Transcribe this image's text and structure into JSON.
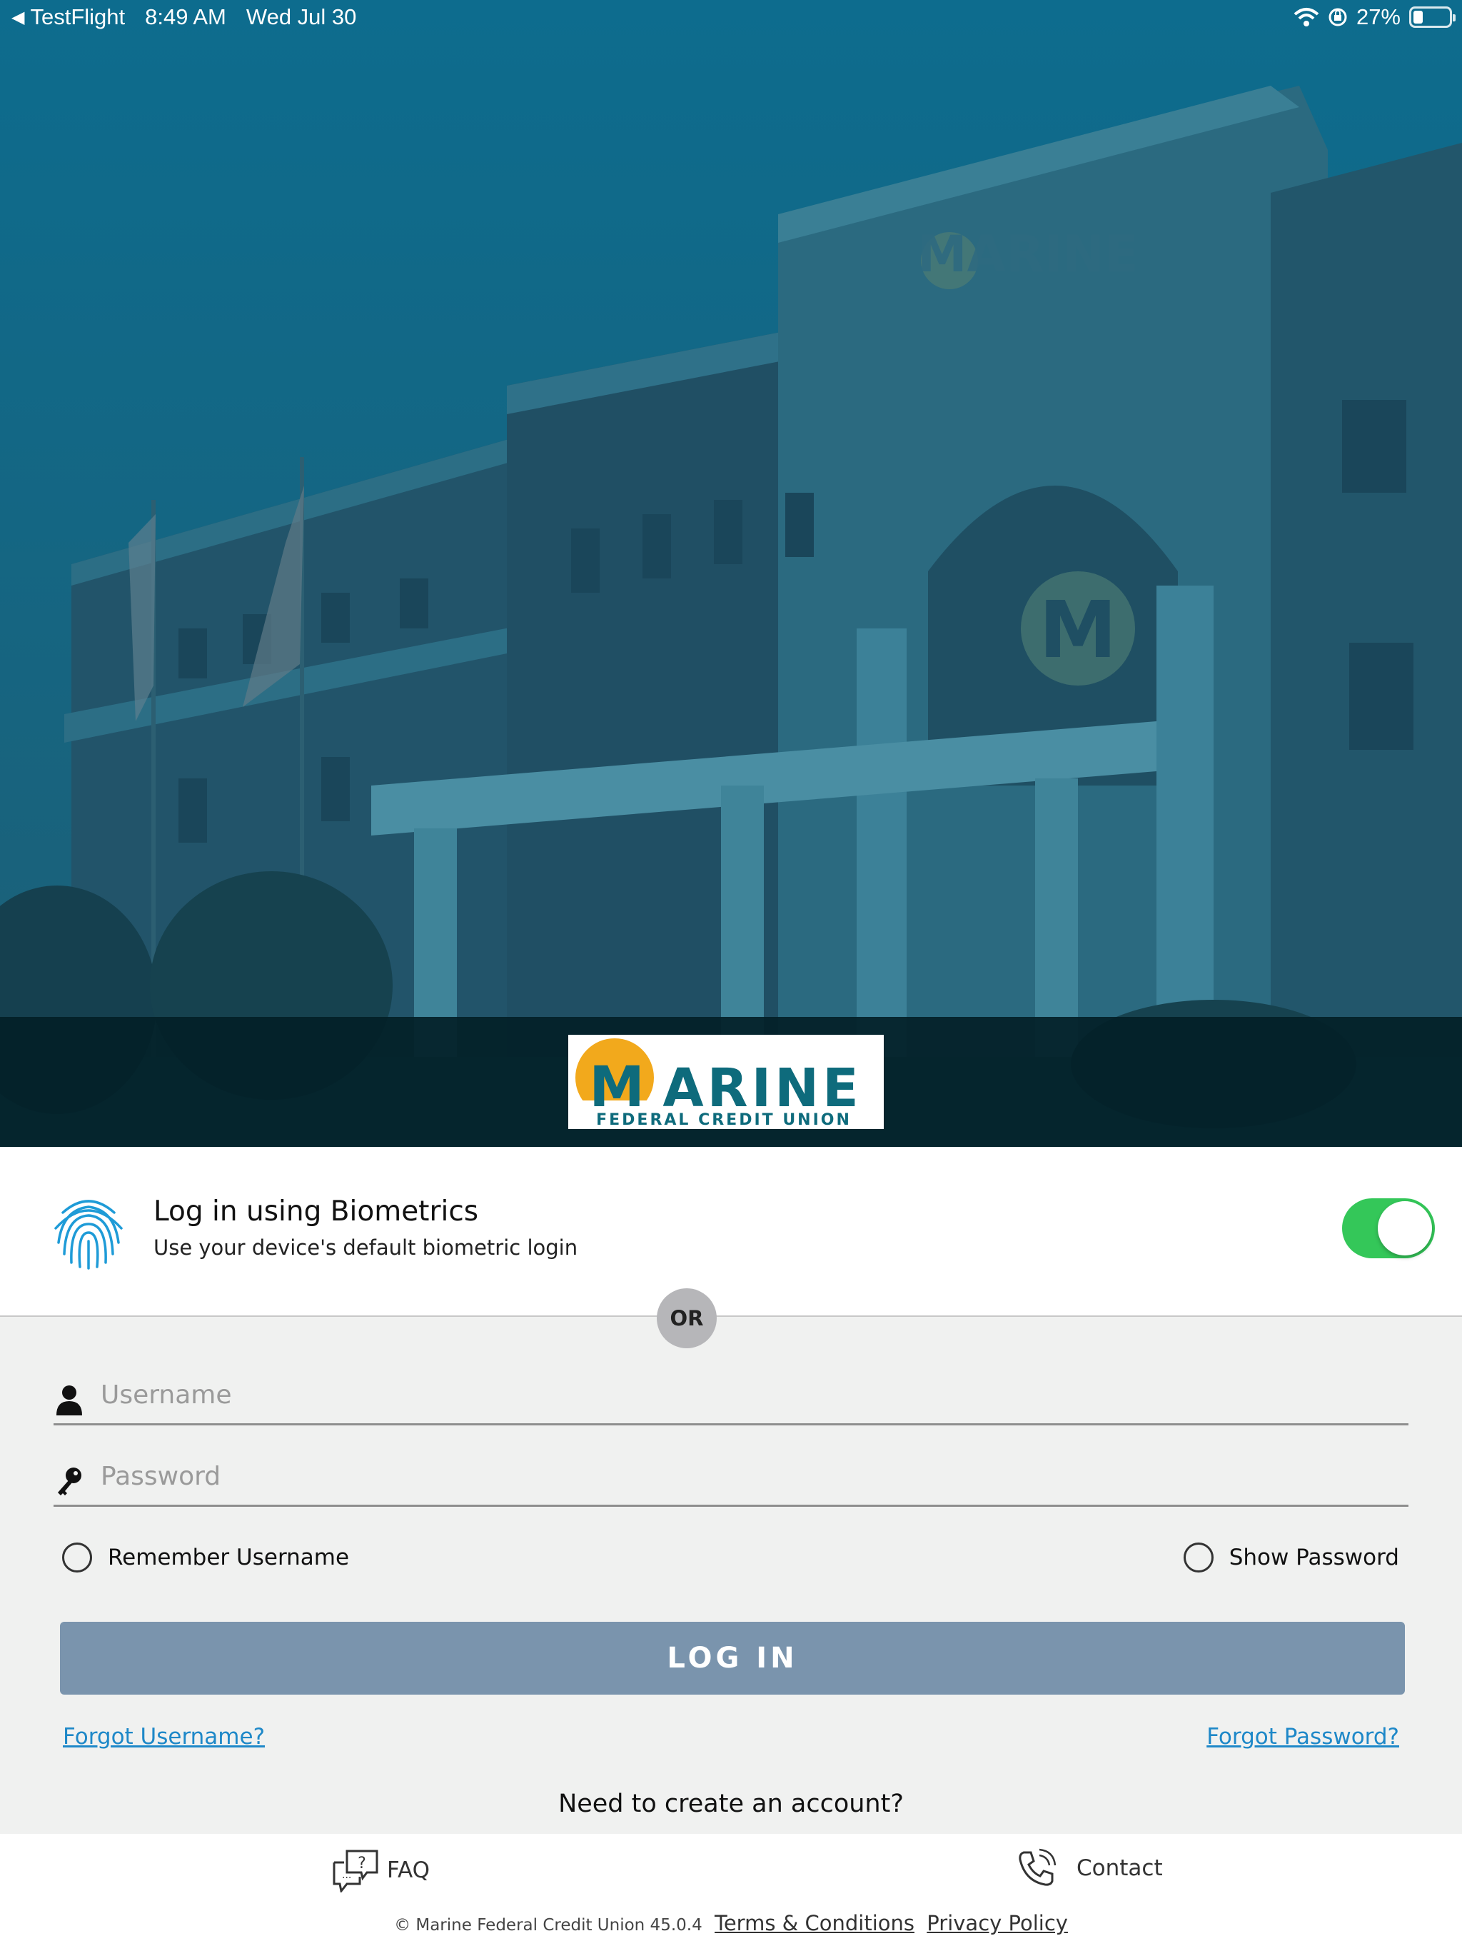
{
  "status_bar": {
    "back_app": "TestFlight",
    "time": "8:49 AM",
    "date": "Wed Jul 30",
    "battery": "27%",
    "battery_level": 0.27
  },
  "brand": {
    "logo_word": "MARINE",
    "logo_sub": "FEDERAL CREDIT UNION",
    "logo_letter": "M",
    "accent_yellow": "#f2a91c",
    "accent_teal": "#0e6b7c"
  },
  "biometrics": {
    "title": "Log in using Biometrics",
    "subtitle": "Use your device's default biometric login",
    "enabled": true,
    "icon": "fingerprint-icon"
  },
  "divider": {
    "label": "OR"
  },
  "form": {
    "username_placeholder": "Username",
    "password_placeholder": "Password",
    "remember_label": "Remember Username",
    "show_password_label": "Show Password",
    "login_label": "LOG IN",
    "forgot_username": "Forgot Username?",
    "forgot_password": "Forgot Password?",
    "create_account": "Need to create an account?"
  },
  "footer": {
    "faq_label": "FAQ",
    "contact_label": "Contact",
    "copyright": "© Marine Federal Credit Union 45.0.4",
    "terms": "Terms & Conditions",
    "privacy": "Privacy Policy"
  },
  "colors": {
    "login_button": "#7a94ad",
    "toggle_on": "#34c759",
    "link": "#1e88c8"
  }
}
